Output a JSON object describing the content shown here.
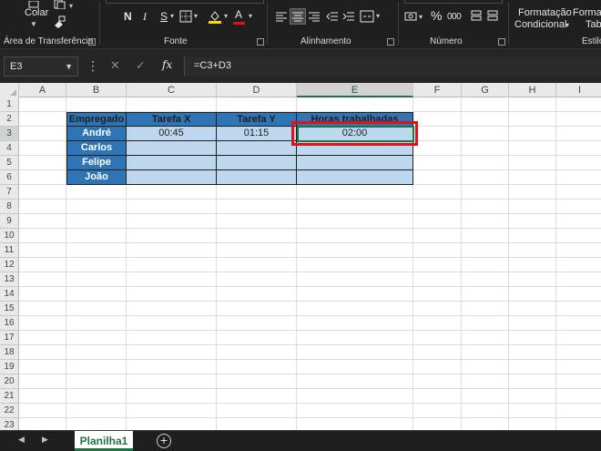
{
  "ribbon": {
    "clipboard": {
      "paste_label": "Colar",
      "group_label": "Área de Transferência"
    },
    "font": {
      "bold": "N",
      "italic": "I",
      "underline": "S",
      "font_color_glyph": "A",
      "group_label": "Fonte"
    },
    "alignment": {
      "group_label": "Alinhamento"
    },
    "number": {
      "percent_glyph": "%",
      "thousands_glyph": "000",
      "group_label": "Número"
    },
    "styles": {
      "conditional_line1": "Formatação",
      "conditional_line2": "Condicional",
      "table_line1": "Formatar",
      "table_line2": "Tabe",
      "group_label": "Estilo"
    }
  },
  "formula_bar": {
    "name_box": "E3",
    "fx_label": "fx",
    "formula": "=C3+D3"
  },
  "grid": {
    "columns": [
      "A",
      "B",
      "C",
      "D",
      "E",
      "F",
      "G",
      "H",
      "I"
    ],
    "rows": [
      "1",
      "2",
      "3",
      "4",
      "5",
      "6",
      "7",
      "8",
      "9",
      "10",
      "11",
      "12",
      "13",
      "14",
      "15",
      "16",
      "17",
      "18",
      "19",
      "20",
      "21",
      "22",
      "23"
    ],
    "active_column": "E",
    "active_row": "3"
  },
  "table": {
    "headers": [
      "Empregado",
      "Tarefa X",
      "Tarefa Y",
      "Horas trabalhadas"
    ],
    "rows": [
      {
        "empregado": "André",
        "tarefa_x": "00:45",
        "tarefa_y": "01:15",
        "horas": "02:00"
      },
      {
        "empregado": "Carlos",
        "tarefa_x": "",
        "tarefa_y": "",
        "horas": ""
      },
      {
        "empregado": "Felipe",
        "tarefa_x": "",
        "tarefa_y": "",
        "horas": ""
      },
      {
        "empregado": "João",
        "tarefa_x": "",
        "tarefa_y": "",
        "horas": ""
      }
    ]
  },
  "colors": {
    "header_fill": "#2f75b5",
    "data_fill": "#bdd7ee",
    "highlight": "#e0111b",
    "excel_green": "#217346"
  },
  "sheet_tabs": {
    "tabs": [
      "Planilha1"
    ],
    "add_glyph": "+"
  }
}
